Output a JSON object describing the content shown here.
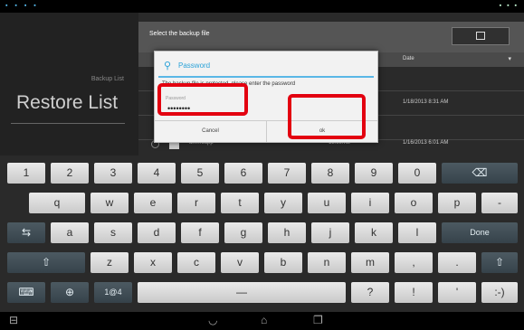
{
  "statusbar": {
    "left_icons": "▪ ▪ ▪ ▪",
    "right_icons": "▪ ▪ ▪"
  },
  "left_pane": {
    "small_label": "Backup List",
    "title": "Restore List"
  },
  "right_pane": {
    "header_title": "Select the backup file",
    "column_date": "Date",
    "column_arrow": "▾",
    "rows": [
      {
        "name": "",
        "size": "",
        "date": ""
      },
      {
        "name": "",
        "size": "",
        "date": "1/18/2013 8:31 AM"
      },
      {
        "name": "",
        "size": "",
        "date": ""
      },
      {
        "name": "ammoapp",
        "size": "13.89MB",
        "date": "1/16/2013 6:01 AM"
      }
    ]
  },
  "dialog": {
    "icon": "⚲",
    "title": "Password",
    "message": "The backup file is protected, please enter the password",
    "label": "Password",
    "password_value": "••••••••",
    "cancel_label": "Cancel",
    "ok_label": "ok"
  },
  "highlight_color": "#e30010",
  "keyboard": {
    "row1": [
      "1",
      "2",
      "3",
      "4",
      "5",
      "6",
      "7",
      "8",
      "9",
      "0",
      "⌫"
    ],
    "row2": [
      "q",
      "w",
      "e",
      "r",
      "t",
      "y",
      "u",
      "i",
      "o",
      "p",
      "-"
    ],
    "row3": [
      "⇆",
      "a",
      "s",
      "d",
      "f",
      "g",
      "h",
      "j",
      "k",
      "l",
      "Done"
    ],
    "row4": [
      "⇧",
      "z",
      "x",
      "c",
      "v",
      "b",
      "n",
      "m",
      ",",
      ".",
      "⇧"
    ],
    "row5": [
      "⌨",
      "⊕",
      "1@4",
      "—",
      "?",
      "!",
      "'",
      ":-)"
    ]
  },
  "navbar": {
    "back": "◡",
    "home": "⌂",
    "recents": "❐",
    "left_icon": "⊟"
  }
}
